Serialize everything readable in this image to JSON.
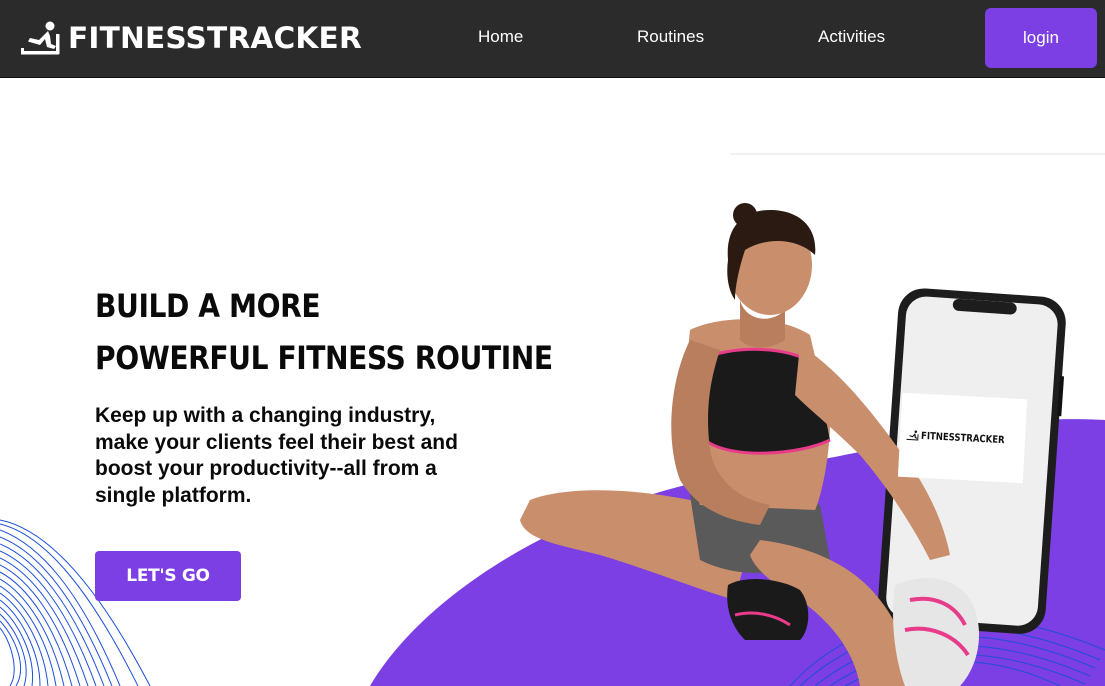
{
  "header": {
    "brand": "FITNESSTRACKER",
    "nav": {
      "home": "Home",
      "routines": "Routines",
      "activities": "Activities"
    },
    "login_label": "login"
  },
  "hero": {
    "title_line1": "BUILD A MORE",
    "title_line2": "POWERFUL FITNESS ROUTINE",
    "subtitle": "Keep up with a changing industry, make your clients feel their best and boost your productivity--all from a single platform.",
    "cta_label": "LET'S GO"
  },
  "phone": {
    "screen_brand": "FITNESSTRACKER"
  },
  "colors": {
    "header_bg": "#2b2b2b",
    "accent": "#7b3fe4",
    "wave": "#1f4fd8"
  },
  "icons": {
    "brand_icon": "treadmill-runner-icon"
  }
}
